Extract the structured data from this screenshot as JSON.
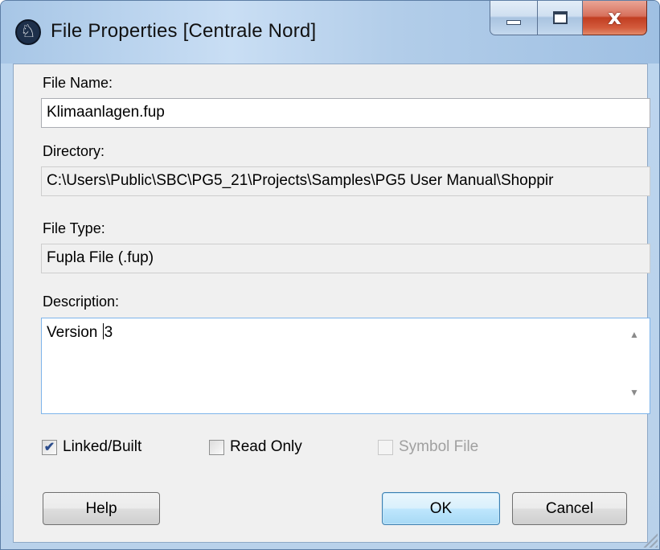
{
  "window": {
    "title": "File Properties [Centrale Nord]",
    "app_icon_glyph": "♘",
    "close_glyph": "x"
  },
  "fields": {
    "file_name_label": "File Name:",
    "file_name_value": "Klimaanlagen.fup",
    "directory_label": "Directory:",
    "directory_value": "C:\\Users\\Public\\SBC\\PG5_21\\Projects\\Samples\\PG5 User Manual\\Shoppir",
    "file_type_label": "File Type:",
    "file_type_value": "Fupla File (.fup)",
    "description_label": "Description:",
    "description_before_caret": "Version ",
    "description_after_caret": "3",
    "scroll_up": "▲",
    "scroll_down": "▼"
  },
  "checkboxes": {
    "linked_built": {
      "label": "Linked/Built",
      "checked": true,
      "mark": "✔"
    },
    "read_only": {
      "label": "Read Only",
      "checked": false
    },
    "symbol_file": {
      "label": "Symbol File",
      "checked": false,
      "enabled": false
    }
  },
  "buttons": {
    "help": "Help",
    "ok": "OK",
    "cancel": "Cancel"
  }
}
